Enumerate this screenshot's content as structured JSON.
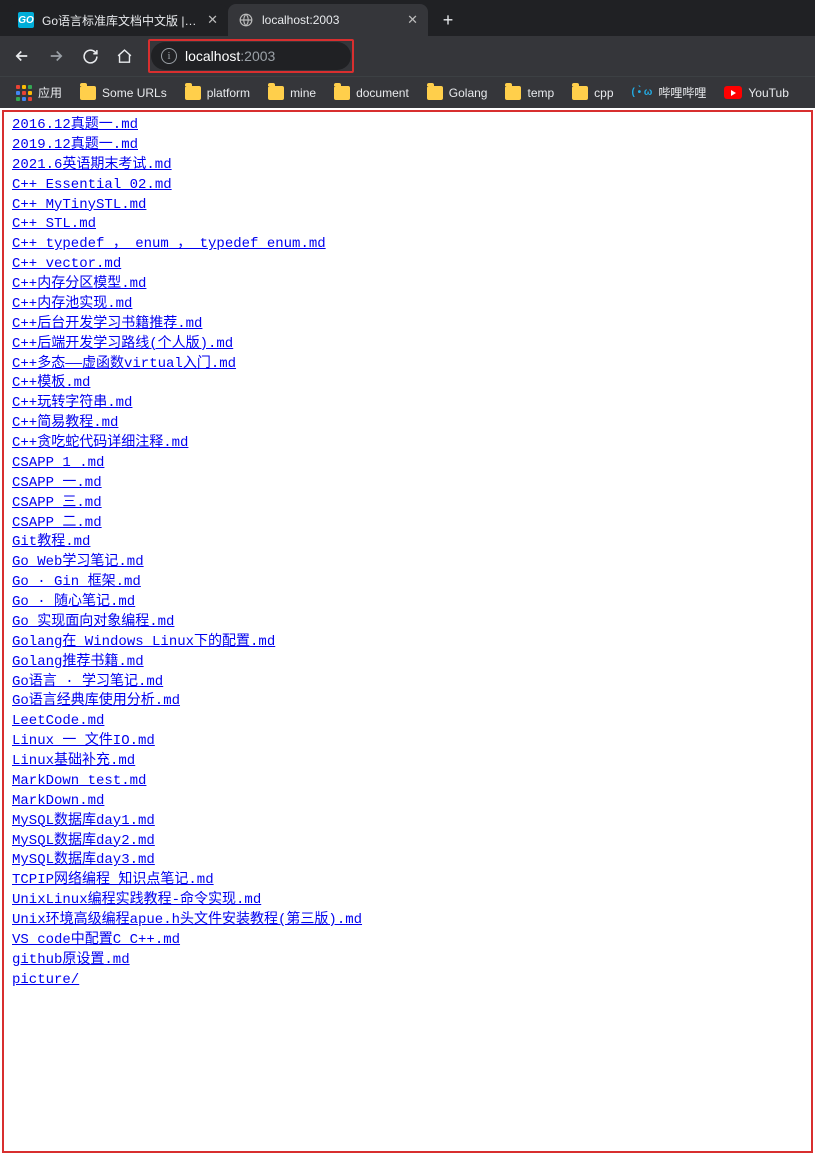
{
  "tabs": [
    {
      "title": "Go语言标准库文档中文版 | Go语",
      "favicon": "go"
    },
    {
      "title": "localhost:2003",
      "favicon": "globe"
    }
  ],
  "active_tab_index": 1,
  "address": {
    "host": "localhost",
    "port": ":2003"
  },
  "bookmarks": {
    "apps_label": "应用",
    "items": [
      {
        "label": "Some URLs",
        "icon": "folder"
      },
      {
        "label": "platform",
        "icon": "folder"
      },
      {
        "label": "mine",
        "icon": "folder"
      },
      {
        "label": "document",
        "icon": "folder"
      },
      {
        "label": "Golang",
        "icon": "folder"
      },
      {
        "label": "temp",
        "icon": "folder"
      },
      {
        "label": "cpp",
        "icon": "folder"
      },
      {
        "label": "哔哩哔哩",
        "icon": "bili"
      },
      {
        "label": "YouTub",
        "icon": "youtube"
      }
    ]
  },
  "files": [
    "2016.12真题一.md",
    "2019.12真题一.md",
    "2021.6英语期末考试.md",
    "C++ Essential 02.md",
    "C++ MyTinySTL.md",
    "C++ STL.md",
    "C++ typedef ， enum ， typedef enum.md",
    "C++ vector.md",
    "C++内存分区模型.md",
    "C++内存池实现.md",
    "C++后台开发学习书籍推荐.md",
    "C++后端开发学习路线(个人版).md",
    "C++多态——虚函数virtual入门.md",
    "C++模板.md",
    "C++玩转字符串.md",
    "C++简易教程.md",
    "C++贪吃蛇代码详细注释.md",
    "CSAPP 1 .md",
    "CSAPP 一.md",
    "CSAPP 三.md",
    "CSAPP 二.md",
    "Git教程.md",
    "Go Web学习笔记.md",
    "Go · Gin 框架.md",
    "Go ·  随心笔记.md",
    "Go 实现面向对象编程.md",
    "Golang在 Windows  Linux下的配置.md",
    "Golang推荐书籍.md",
    "Go语言 · 学习笔记.md",
    "Go语言经典库使用分析.md",
    "LeetCode.md",
    "Linux 一 文件IO.md",
    "Linux基础补充.md",
    "MarkDown test.md",
    "MarkDown.md",
    "MySQL数据库day1.md",
    "MySQL数据库day2.md",
    "MySQL数据库day3.md",
    "TCPIP网络编程 知识点笔记.md",
    "UnixLinux编程实践教程-命令实现.md",
    "Unix环境高级编程apue.h头文件安装教程(第三版).md",
    "VS code中配置C C++.md",
    "github原设置.md",
    "picture/"
  ]
}
